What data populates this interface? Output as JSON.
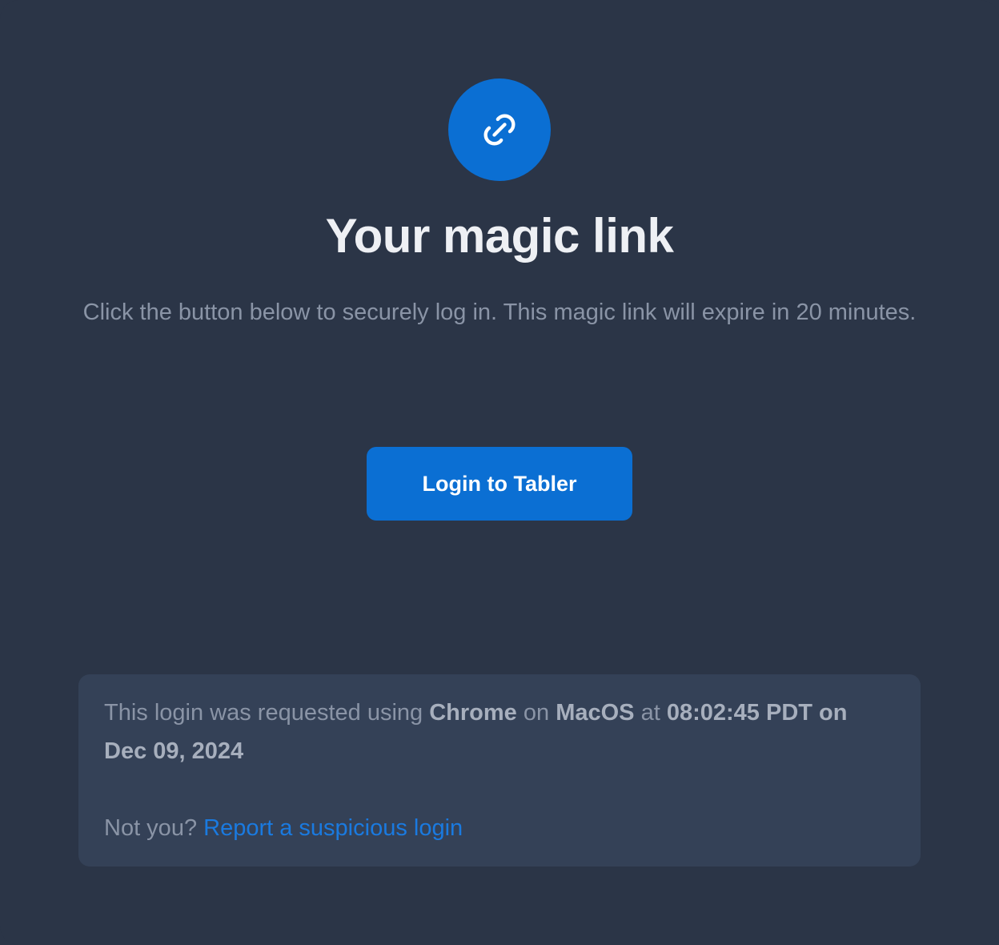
{
  "icon": {
    "name": "link-icon",
    "color": "#0b6fd3"
  },
  "title": "Your magic link",
  "subtitle": "Click the button below to securely log in. This magic link will expire in 20 minutes.",
  "button": {
    "label": "Login to Tabler",
    "color": "#0b6fd3"
  },
  "info": {
    "prefix": "This login was requested using",
    "browser": "Chrome",
    "on_word": "on",
    "os": "MacOS",
    "at_word": "at",
    "datetime": "08:02:45 PDT on Dec 09, 2024",
    "not_you": "Not you?",
    "report_link": "Report a suspicious login"
  }
}
